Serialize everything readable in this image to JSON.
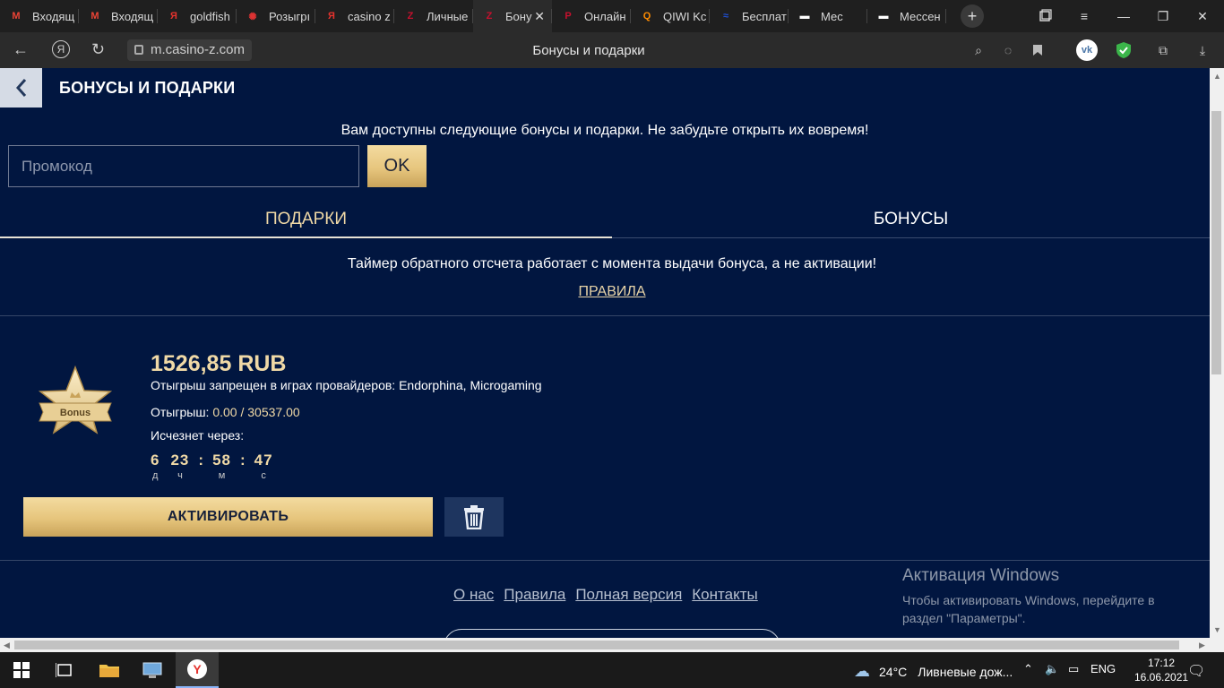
{
  "browser": {
    "tabs": [
      {
        "label": "Входящ",
        "fav_color": "#ea4335",
        "fav_glyph": "M"
      },
      {
        "label": "Входящ",
        "fav_color": "#ea4335",
        "fav_glyph": "M"
      },
      {
        "label": "goldfish",
        "fav_color": "#e5322d",
        "fav_glyph": "Я"
      },
      {
        "label": "Розыгрı",
        "fav_color": "#d33",
        "fav_glyph": "✺"
      },
      {
        "label": "casino z",
        "fav_color": "#e5322d",
        "fav_glyph": "Я"
      },
      {
        "label": "Личные",
        "fav_color": "#c8102e",
        "fav_glyph": "Z"
      },
      {
        "label": "Бону",
        "fav_color": "#c8102e",
        "fav_glyph": "Z",
        "active": true
      },
      {
        "label": "Онлайн",
        "fav_color": "#c8102e",
        "fav_glyph": "P"
      },
      {
        "label": "QIWI Kc",
        "fav_color": "#ff8c00",
        "fav_glyph": "Q"
      },
      {
        "label": "Бесплат",
        "fav_color": "#1f4fd6",
        "fav_glyph": "≈"
      },
      {
        "label": "Мес",
        "fav_color": "#fff",
        "fav_glyph": "▬"
      },
      {
        "label": "Мессен",
        "fav_color": "#fff",
        "fav_glyph": "▬"
      }
    ],
    "url": "m.casino-z.com",
    "page_title": "Бонусы и подарки",
    "accent_color": "#f0d9a6"
  },
  "page": {
    "header_title": "БОНУСЫ И ПОДАРКИ",
    "notice": "Вам доступны следующие бонусы и подарки. Не забудьте открыть их вовремя!",
    "promo_placeholder": "Промокод",
    "ok_label": "OK",
    "tab_gifts": "ПОДАРКИ",
    "tab_bonuses": "БОНУСЫ",
    "timer_note": "Таймер обратного отсчета работает с момента выдачи бонуса, а не активации!",
    "rules_link": "ПРАВИЛА"
  },
  "bonus": {
    "badge_text": "Bonus",
    "amount": "1526,85 RUB",
    "restriction": "Отыгрыш запрещен в играх провайдеров: Endorphina, Microgaming",
    "wager_label": "Отыгрыш:",
    "wager_value": "0.00 / 30537.00",
    "expires_label": "Исчезнет через:",
    "countdown": {
      "days": "6",
      "days_unit": "д",
      "hours": "23",
      "hours_unit": "ч",
      "minutes": "58",
      "minutes_unit": "м",
      "seconds": "47",
      "seconds_unit": "с"
    },
    "activate_label": "АКТИВИРОВАТЬ"
  },
  "footer": {
    "links": [
      "О нас",
      "Правила",
      "Полная версия",
      "Контакты"
    ]
  },
  "windows_activation": {
    "title": "Активация Windows",
    "text": "Чтобы активировать Windows, перейдите в раздел \"Параметры\"."
  },
  "taskbar": {
    "weather_temp": "24°C",
    "weather_text": "Ливневые дож...",
    "lang": "ENG",
    "time": "17:12",
    "date": "16.06.2021"
  }
}
